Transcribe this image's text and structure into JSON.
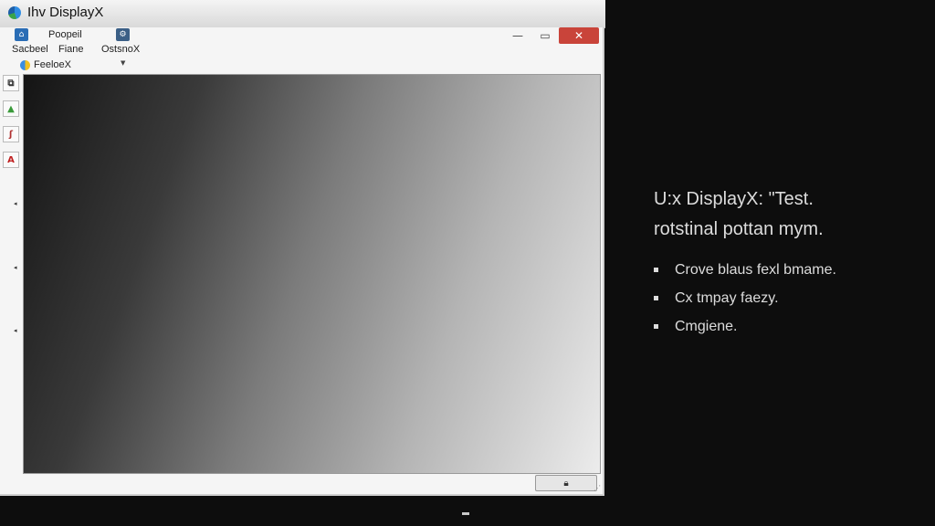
{
  "window": {
    "title": "Ihv DisplayX",
    "controls": {
      "minimize": "—",
      "maximize": "▭",
      "close": "✕"
    }
  },
  "menu": {
    "items": [
      {
        "label": "Sacbeel"
      },
      {
        "label": "Poopeil"
      },
      {
        "label": "Fiane"
      },
      {
        "label": "OstsnoX"
      }
    ],
    "sub_label": "FeeloeX"
  },
  "toolbar": {
    "tools": [
      {
        "icon": "window-icon",
        "glyph": "⧉"
      },
      {
        "icon": "fill-icon",
        "glyph": "▲"
      },
      {
        "icon": "brush-icon",
        "glyph": "ʃ"
      },
      {
        "icon": "text-icon",
        "glyph": "A"
      }
    ]
  },
  "status": {
    "lock_glyph": "🔒︎"
  },
  "info": {
    "title": "U:x DisplayX:   \"Test.",
    "subtitle": "rotstinal pottan mym.",
    "bullets": [
      "Crove blaus fexl bmame.",
      "Cx tmpay faezy.",
      "Cmgiene."
    ]
  },
  "colors": {
    "close_button": "#c9443a",
    "background": "#0d0d0d",
    "info_text": "#dcdcdc"
  }
}
